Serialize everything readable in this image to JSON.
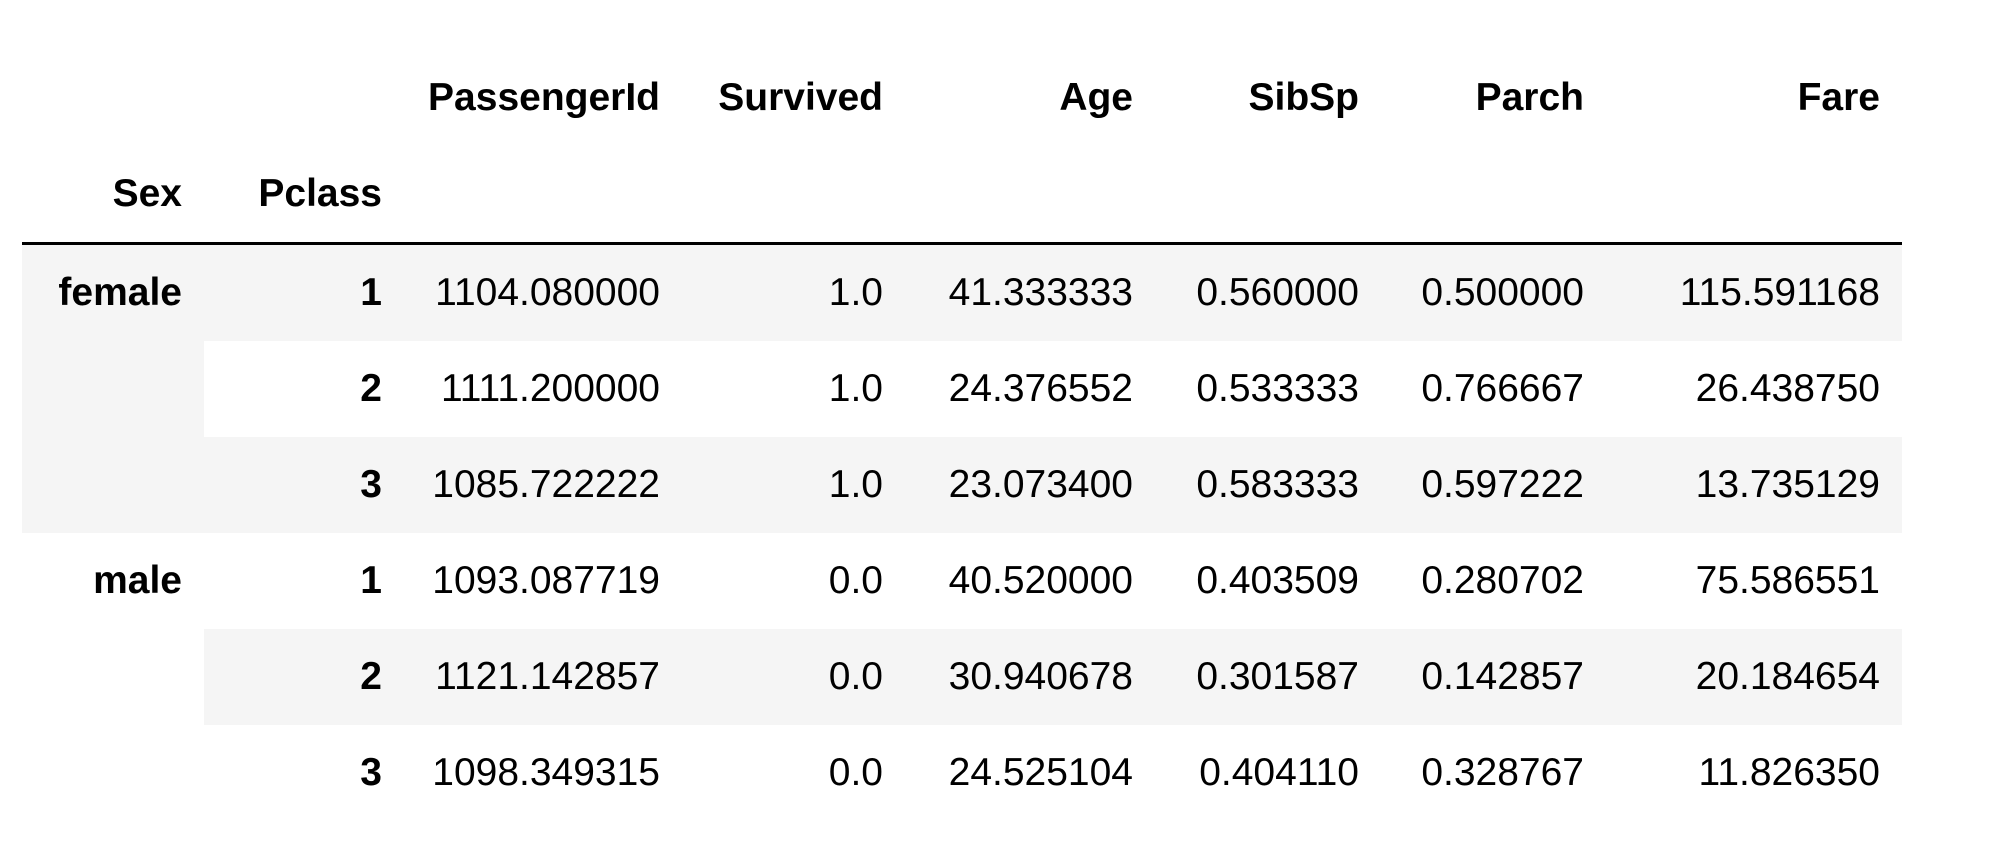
{
  "table": {
    "columns": [
      "PassengerId",
      "Survived",
      "Age",
      "SibSp",
      "Parch",
      "Fare"
    ],
    "index_names": [
      "Sex",
      "Pclass"
    ],
    "groups": [
      {
        "sex": "female",
        "rows": [
          {
            "pclass": "1",
            "values": [
              "1104.080000",
              "1.0",
              "41.333333",
              "0.560000",
              "0.500000",
              "115.591168"
            ]
          },
          {
            "pclass": "2",
            "values": [
              "1111.200000",
              "1.0",
              "24.376552",
              "0.533333",
              "0.766667",
              "26.438750"
            ]
          },
          {
            "pclass": "3",
            "values": [
              "1085.722222",
              "1.0",
              "23.073400",
              "0.583333",
              "0.597222",
              "13.735129"
            ]
          }
        ]
      },
      {
        "sex": "male",
        "rows": [
          {
            "pclass": "1",
            "values": [
              "1093.087719",
              "0.0",
              "40.520000",
              "0.403509",
              "0.280702",
              "75.586551"
            ]
          },
          {
            "pclass": "2",
            "values": [
              "1121.142857",
              "0.0",
              "30.940678",
              "0.301587",
              "0.142857",
              "20.184654"
            ]
          },
          {
            "pclass": "3",
            "values": [
              "1098.349315",
              "0.0",
              "24.525104",
              "0.404110",
              "0.328767",
              "11.826350"
            ]
          }
        ]
      }
    ]
  }
}
